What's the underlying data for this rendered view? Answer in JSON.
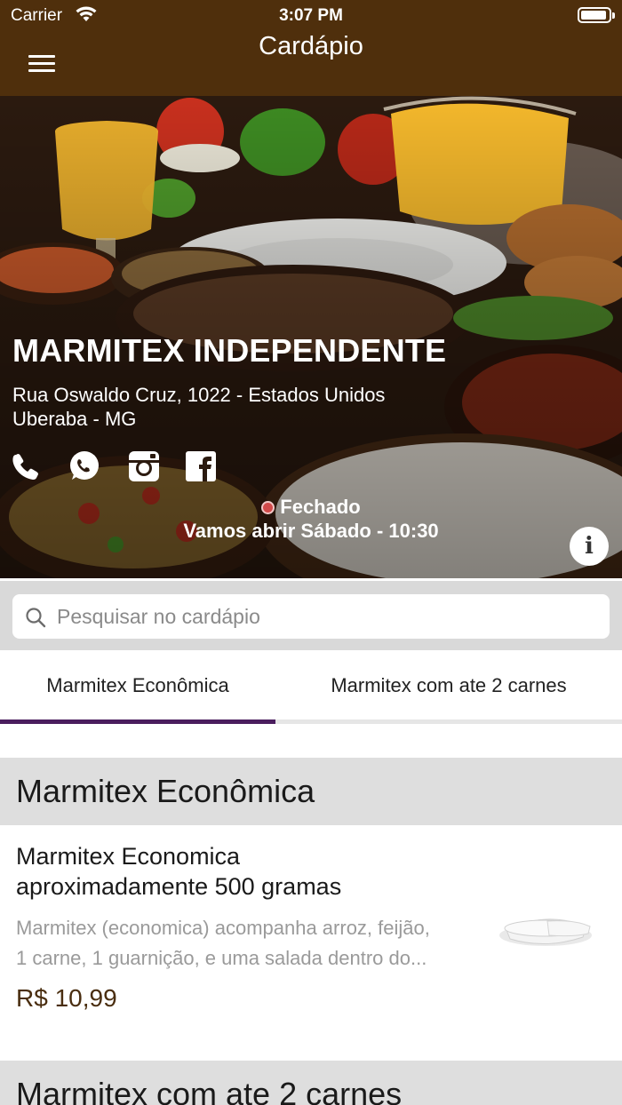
{
  "status_bar": {
    "carrier": "Carrier",
    "time": "3:07 PM"
  },
  "nav": {
    "title": "Cardápio",
    "menu_icon": "hamburger-menu-icon"
  },
  "restaurant": {
    "name": "MARMITEX INDEPENDENTE",
    "address_line1": "Rua Oswaldo Cruz, 1022 - Estados Unidos",
    "address_line2": "Uberaba - MG",
    "status": "Fechado",
    "opening": "Vamos abrir Sábado - 10:30",
    "status_color": "#d14a4a",
    "social_icons": [
      "phone-icon",
      "whatsapp-icon",
      "instagram-icon",
      "facebook-icon"
    ],
    "info_label": "i"
  },
  "search": {
    "placeholder": "Pesquisar no cardápio",
    "value": ""
  },
  "tabs": [
    {
      "label": "Marmitex Econômica",
      "active": true
    },
    {
      "label": "Marmitex com ate 2 carnes",
      "active": false
    }
  ],
  "sections": [
    {
      "title": "Marmitex Econômica",
      "items": [
        {
          "title_line1": "Marmitex Economica",
          "title_line2": "aproximadamente 500 gramas",
          "desc_line1": "Marmitex (economica) acompanha arroz, feijão,",
          "desc_line2": "1 carne, 1 guarnição, e uma salada dentro do...",
          "price": "R$ 10,99"
        }
      ]
    },
    {
      "title": "Marmitex com ate 2 carnes"
    }
  ],
  "colors": {
    "header_bg": "#4f2f0c",
    "tab_indicator": "#4a1d5e",
    "price": "#4a2e10"
  }
}
